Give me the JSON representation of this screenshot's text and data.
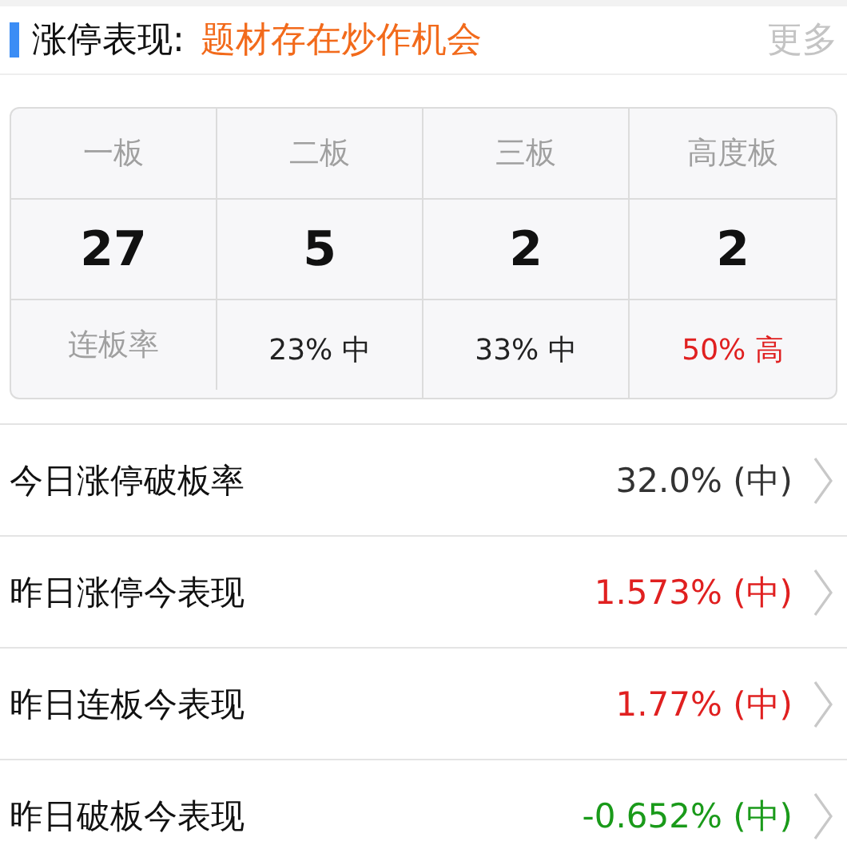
{
  "header": {
    "title": "涨停表现:",
    "subtitle": "题材存在炒作机会",
    "more": "更多"
  },
  "board_table": {
    "columns": [
      "一板",
      "二板",
      "三板",
      "高度板"
    ],
    "counts": [
      "27",
      "5",
      "2",
      "2"
    ],
    "rate_label": "连板率",
    "rates": [
      {
        "text": "23% 中",
        "color": "#222222"
      },
      {
        "text": "33% 中",
        "color": "#222222"
      },
      {
        "text": "50% 高",
        "color": "#e02020"
      }
    ]
  },
  "metrics": [
    {
      "label": "今日涨停破板率",
      "value": "32.0% (中)",
      "color": "#333333"
    },
    {
      "label": "昨日涨停今表现",
      "value": "1.573% (中)",
      "color": "#e02020"
    },
    {
      "label": "昨日连板今表现",
      "value": "1.77% (中)",
      "color": "#e02020"
    },
    {
      "label": "昨日破板今表现",
      "value": "-0.652% (中)",
      "color": "#1a9a1a"
    }
  ]
}
